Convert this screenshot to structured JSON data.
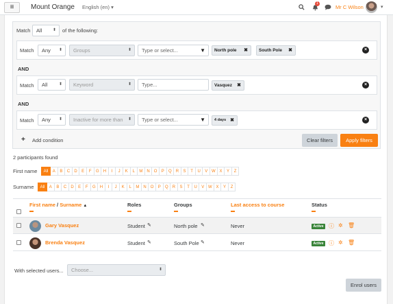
{
  "navbar": {
    "menu_glyph": "≡",
    "site_name": "Mount Orange",
    "language": "English (en)",
    "user_name": "Mr C Wilson",
    "notification_count": "1",
    "icons": [
      "search-icon",
      "bell-icon",
      "comment-icon"
    ]
  },
  "filters": {
    "match_label": "Match",
    "match_value": "All",
    "match_suffix": "of the following:",
    "rows": [
      {
        "match_label": "Match",
        "match": "Any",
        "field": "Groups",
        "input_placeholder": "Type or select...",
        "tags": [
          "North pole",
          "South Pole"
        ]
      },
      {
        "match_label": "Match",
        "match": "All",
        "field": "Keyword",
        "input_placeholder": "Type...",
        "tags": [
          "Vasquez"
        ]
      },
      {
        "match_label": "Match",
        "match": "Any",
        "field": "Inactive for more than",
        "input_placeholder": "Type or select...",
        "tags": [
          "4 days"
        ]
      }
    ],
    "and_label": "AND",
    "add_condition": "Add condition",
    "clear_button": "Clear filters",
    "apply_button": "Apply filters"
  },
  "participants_found": "2 participants found",
  "first_name_label": "First name",
  "surname_label": "Surname",
  "alphabet": [
    "All",
    "A",
    "B",
    "C",
    "D",
    "E",
    "F",
    "G",
    "H",
    "I",
    "J",
    "K",
    "L",
    "M",
    "N",
    "O",
    "P",
    "Q",
    "R",
    "S",
    "T",
    "U",
    "V",
    "W",
    "X",
    "Y",
    "Z"
  ],
  "table": {
    "headers": {
      "first_name": "First name",
      "sep": " / ",
      "surname": "Surname",
      "sort_glyph": "▲",
      "roles": "Roles",
      "groups": "Groups",
      "last_access": "Last access to course",
      "status": "Status"
    },
    "rows": [
      {
        "name": "Gary Vasquez",
        "role": "Student",
        "group": "North pole",
        "last_access": "Never",
        "status": "Active"
      },
      {
        "name": "Brenda Vasquez",
        "role": "Student",
        "group": "South Pole",
        "last_access": "Never",
        "status": "Active"
      }
    ]
  },
  "bulk": {
    "label": "With selected users...",
    "placeholder": "Choose..."
  },
  "enrol_button": "Enrol users",
  "colors": {
    "accent": "#f98012",
    "active_badge": "#398439"
  }
}
